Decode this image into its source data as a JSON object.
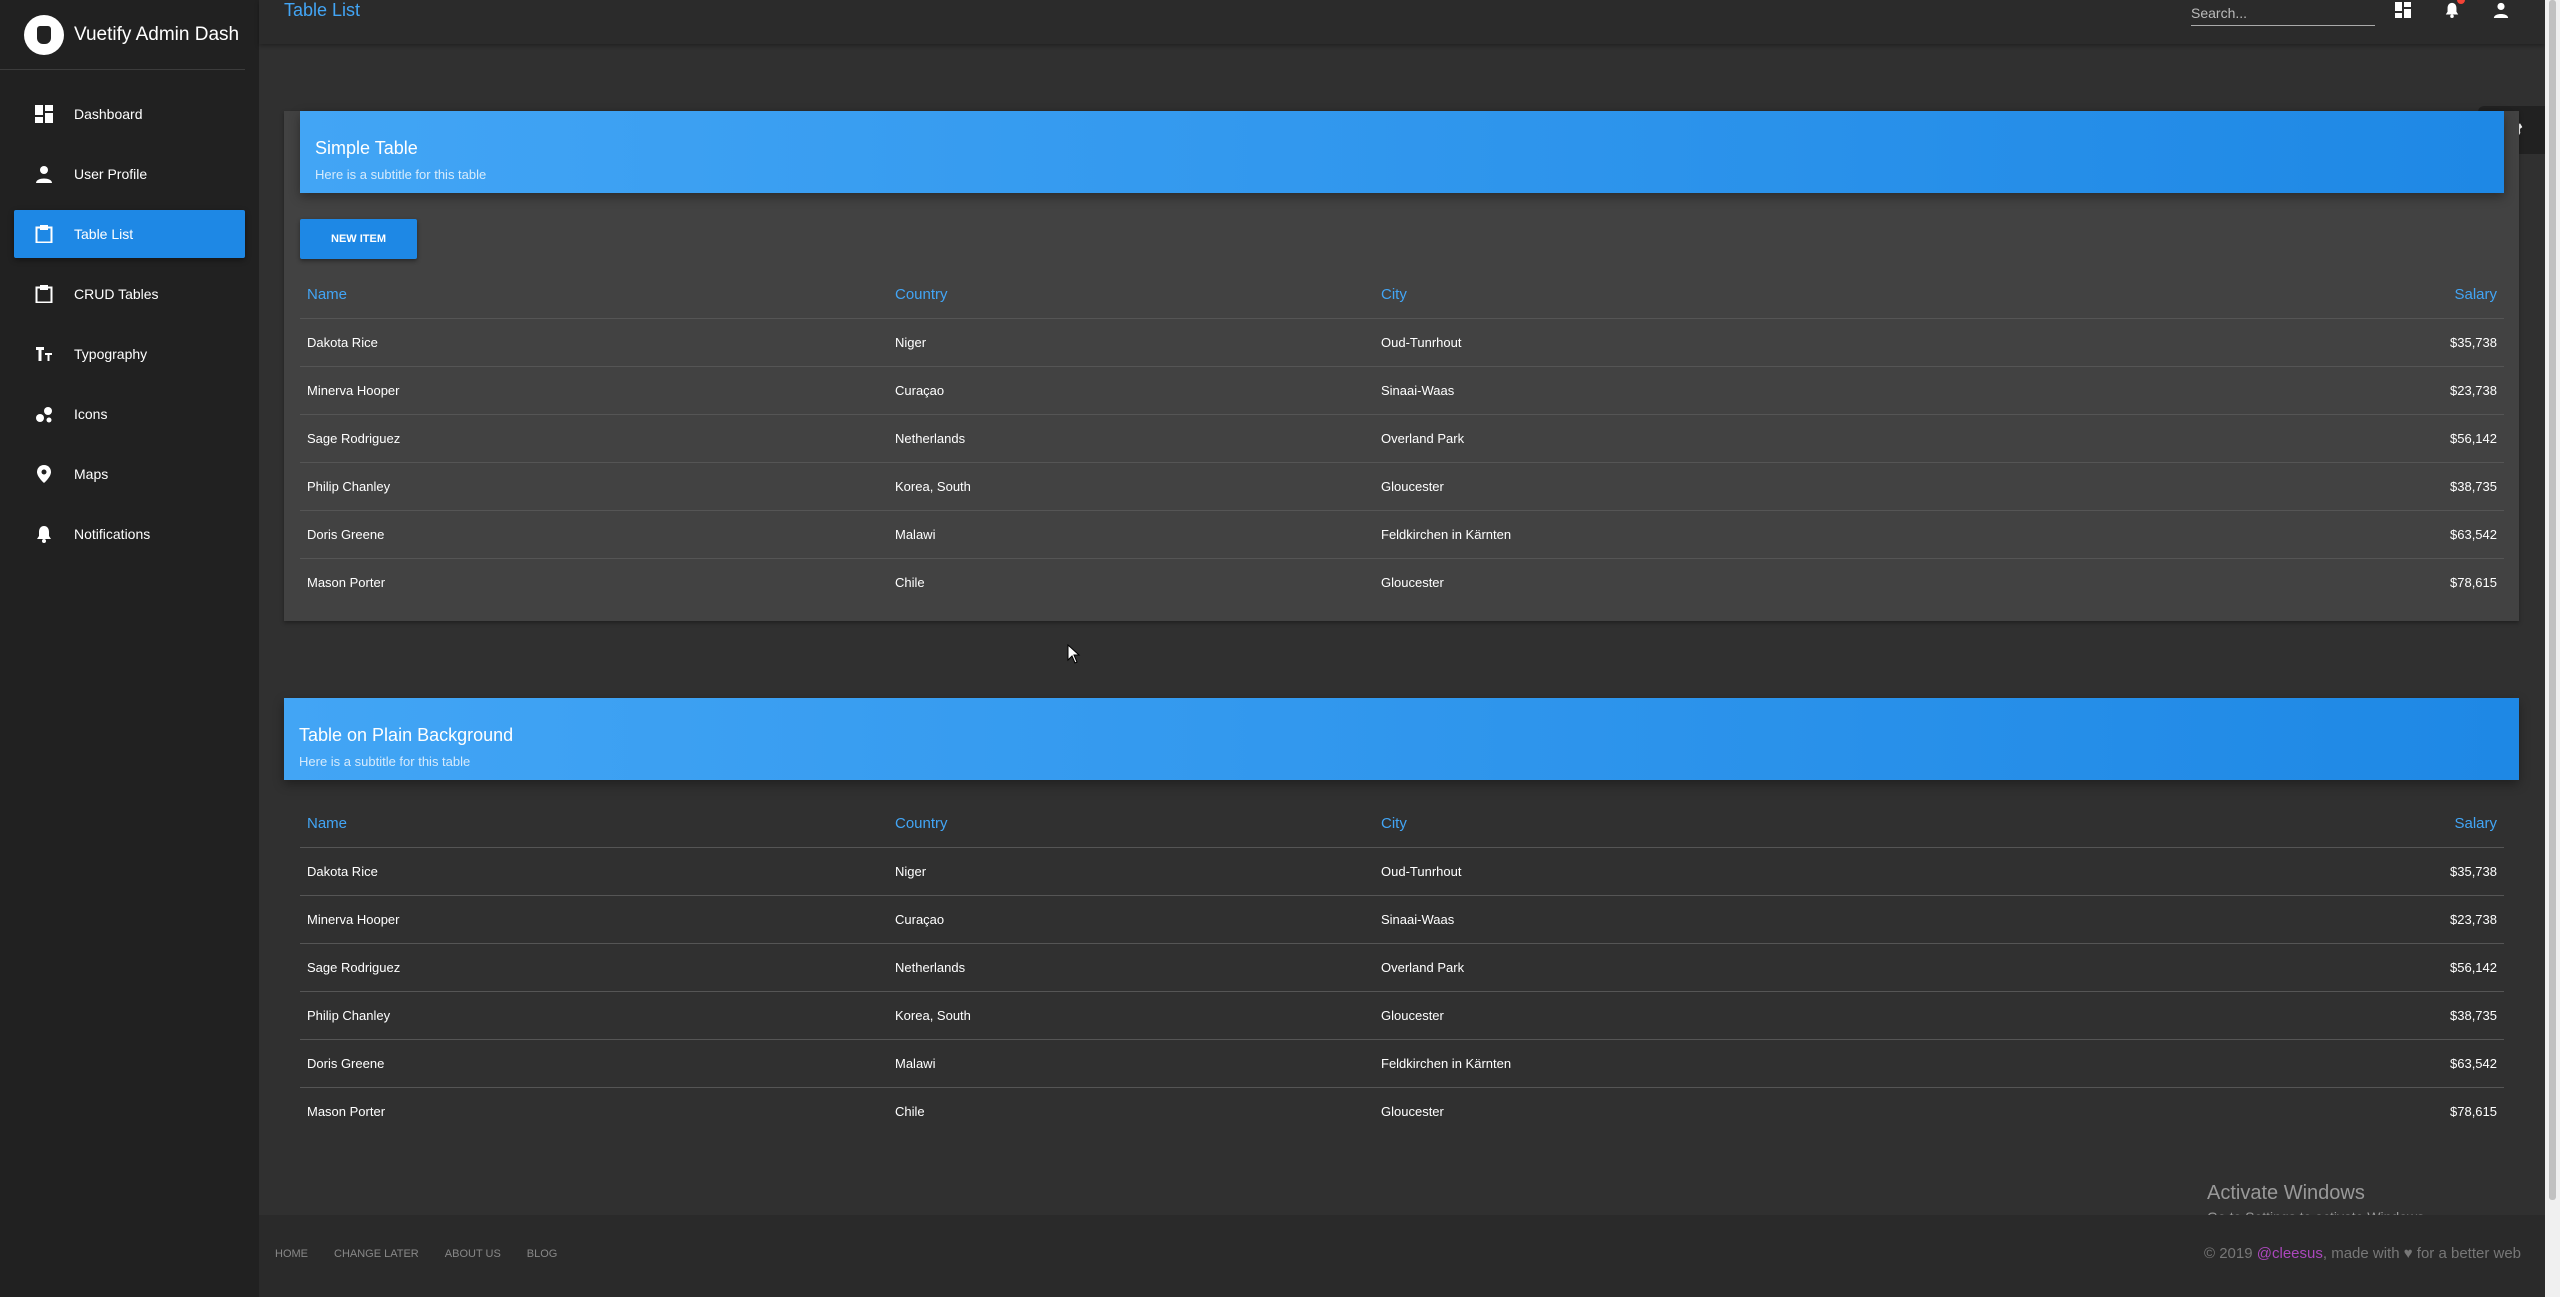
{
  "sidebar": {
    "brand": "Vuetify Admin Dash",
    "items": [
      {
        "label": "Dashboard",
        "icon": "dashboard-icon",
        "active": false
      },
      {
        "label": "User Profile",
        "icon": "person-icon",
        "active": false
      },
      {
        "label": "Table List",
        "icon": "clipboard-icon",
        "active": true
      },
      {
        "label": "CRUD Tables",
        "icon": "clipboard-icon",
        "active": false
      },
      {
        "label": "Typography",
        "icon": "format-font-icon",
        "active": false
      },
      {
        "label": "Icons",
        "icon": "bubble-chart-icon",
        "active": false
      },
      {
        "label": "Maps",
        "icon": "map-marker-icon",
        "active": false
      },
      {
        "label": "Notifications",
        "icon": "bell-icon",
        "active": false
      }
    ]
  },
  "topbar": {
    "title": "Table List",
    "search_placeholder": "Search..."
  },
  "tables": [
    {
      "title": "Simple Table",
      "subtitle": "Here is a subtitle for this table",
      "button": "NEW ITEM",
      "headers": {
        "name": "Name",
        "country": "Country",
        "city": "City",
        "salary": "Salary"
      },
      "rows": [
        {
          "name": "Dakota Rice",
          "country": "Niger",
          "city": "Oud-Tunrhout",
          "salary": "$35,738"
        },
        {
          "name": "Minerva Hooper",
          "country": "Curaçao",
          "city": "Sinaai-Waas",
          "salary": "$23,738"
        },
        {
          "name": "Sage Rodriguez",
          "country": "Netherlands",
          "city": "Overland Park",
          "salary": "$56,142"
        },
        {
          "name": "Philip Chanley",
          "country": "Korea, South",
          "city": "Gloucester",
          "salary": "$38,735"
        },
        {
          "name": "Doris Greene",
          "country": "Malawi",
          "city": "Feldkirchen in Kärnten",
          "salary": "$63,542"
        },
        {
          "name": "Mason Porter",
          "country": "Chile",
          "city": "Gloucester",
          "salary": "$78,615"
        }
      ]
    },
    {
      "title": "Table on Plain Background",
      "subtitle": "Here is a subtitle for this table",
      "headers": {
        "name": "Name",
        "country": "Country",
        "city": "City",
        "salary": "Salary"
      },
      "rows": [
        {
          "name": "Dakota Rice",
          "country": "Niger",
          "city": "Oud-Tunrhout",
          "salary": "$35,738"
        },
        {
          "name": "Minerva Hooper",
          "country": "Curaçao",
          "city": "Sinaai-Waas",
          "salary": "$23,738"
        },
        {
          "name": "Sage Rodriguez",
          "country": "Netherlands",
          "city": "Overland Park",
          "salary": "$56,142"
        },
        {
          "name": "Philip Chanley",
          "country": "Korea, South",
          "city": "Gloucester",
          "salary": "$38,735"
        },
        {
          "name": "Doris Greene",
          "country": "Malawi",
          "city": "Feldkirchen in Kärnten",
          "salary": "$63,542"
        },
        {
          "name": "Mason Porter",
          "country": "Chile",
          "city": "Gloucester",
          "salary": "$78,615"
        }
      ]
    }
  ],
  "footer": {
    "links": [
      "HOME",
      "CHANGE LATER",
      "ABOUT US",
      "BLOG"
    ],
    "copyright_prefix": "© 2019 ",
    "author": "@cleesus",
    "copyright_suffix": ", made with ♥ for a better web"
  },
  "watermark": {
    "title": "Activate Windows",
    "subtitle": "Go to Settings to activate Windows."
  },
  "colors": {
    "accent": "#1e88e5",
    "accent_light": "#42a5f5",
    "background": "#303030",
    "sidebar": "#212121",
    "card": "#424242",
    "author_link": "#ab47bc"
  }
}
